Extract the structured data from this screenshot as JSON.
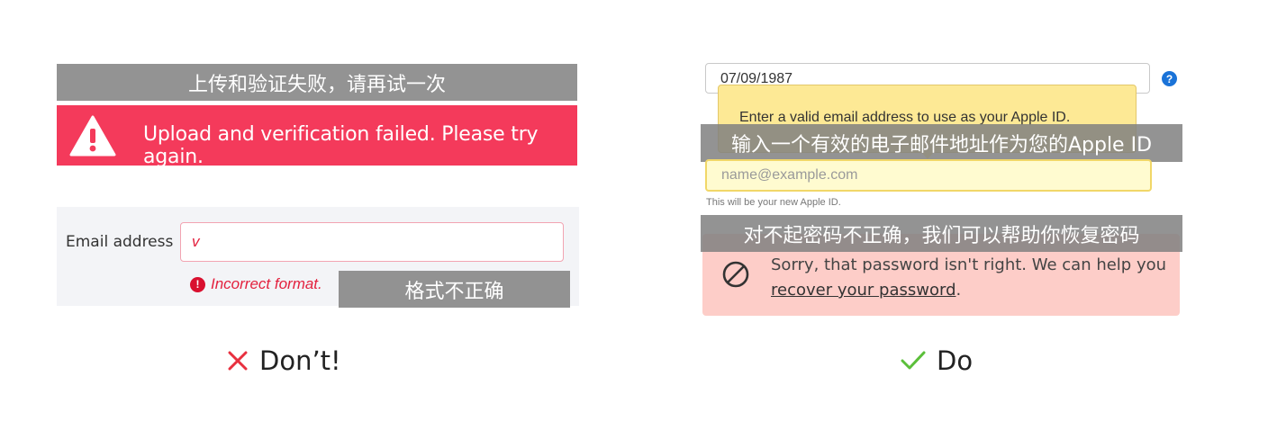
{
  "dont": {
    "caption_upload": "上传和验证失败，请再试一次",
    "banner_text": "Upload and verification failed. Please try again.",
    "email_label": "Email address",
    "email_value": "v",
    "error_text": "Incorrect format.",
    "caption_format": "格式不正确",
    "verdict_label": "Don’t!",
    "verdict_icon": "x-icon",
    "verdict_color": "#e8303f"
  },
  "do": {
    "date_value": "07/09/1987",
    "help_icon": "?",
    "tooltip_text": "Enter a valid email address to use as your Apple ID.",
    "caption_email": "输入一个有效的电子邮件地址作为您的Apple ID",
    "email_placeholder": "name@example.com",
    "hint_text": "This will be your new Apple ID.",
    "caption_password": "对不起密码不正确，我们可以帮助你恢复密码",
    "alert_text_before": "Sorry, that password isn't right. We can help you ",
    "alert_link": "recover your password",
    "alert_text_after": ".",
    "verdict_label": "Do",
    "verdict_icon": "check-icon",
    "verdict_color": "#5bbf3a"
  },
  "colors": {
    "error_banner": "#f43a5b",
    "tooltip_bg": "#fde995",
    "alert_bg": "#fdcdc8",
    "caption_bg": "#808080"
  }
}
